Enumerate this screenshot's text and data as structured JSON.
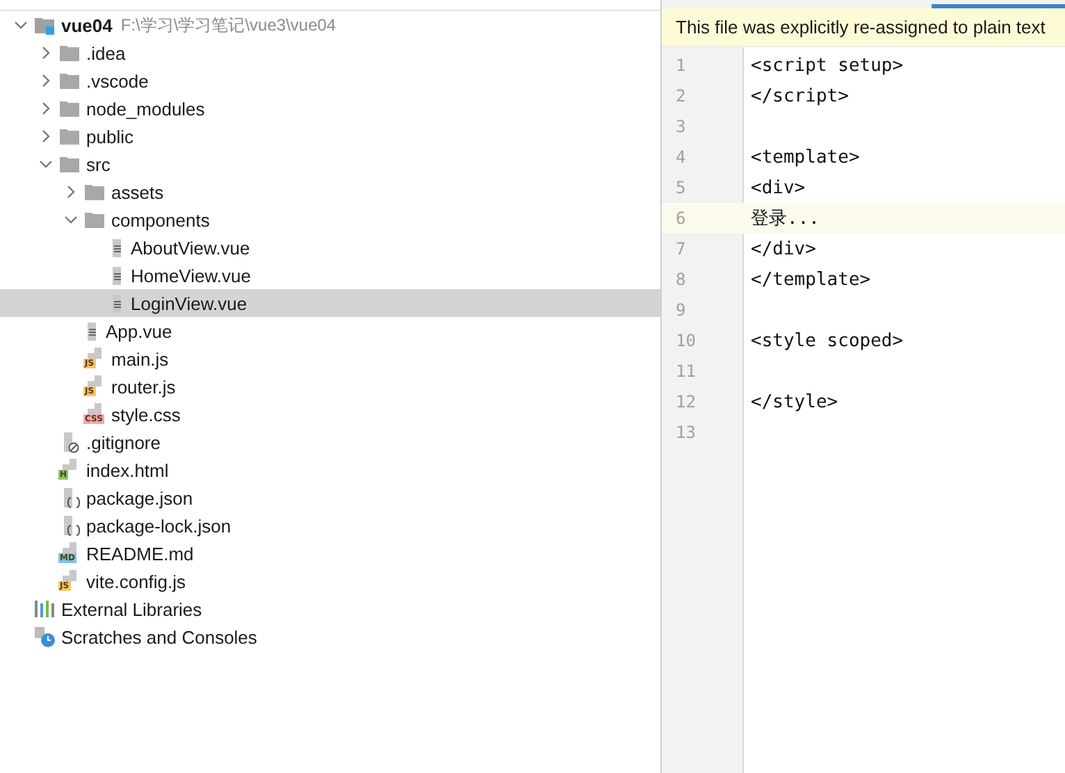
{
  "tree": [
    {
      "kind": "module",
      "label": "vue04",
      "path": "F:\\学习\\学习笔记\\vue3\\vue04",
      "expanded": true,
      "selected": false,
      "children": [
        {
          "kind": "folder",
          "label": ".idea",
          "expanded": false,
          "selected": false
        },
        {
          "kind": "folder",
          "label": ".vscode",
          "expanded": false,
          "selected": false
        },
        {
          "kind": "folder",
          "label": "node_modules",
          "expanded": false,
          "selected": false
        },
        {
          "kind": "folder",
          "label": "public",
          "expanded": false,
          "selected": false
        },
        {
          "kind": "folder",
          "label": "src",
          "expanded": true,
          "selected": false,
          "children": [
            {
              "kind": "folder",
              "label": "assets",
              "expanded": false,
              "selected": false
            },
            {
              "kind": "folder",
              "label": "components",
              "expanded": true,
              "selected": false,
              "children": [
                {
                  "kind": "text",
                  "label": "AboutView.vue",
                  "selected": false
                },
                {
                  "kind": "text",
                  "label": "HomeView.vue",
                  "selected": false
                },
                {
                  "kind": "text",
                  "label": "LoginView.vue",
                  "selected": true
                }
              ]
            },
            {
              "kind": "text",
              "label": "App.vue",
              "selected": false
            },
            {
              "kind": "badge",
              "label": "main.js",
              "badge": "JS",
              "color": "#f4c56c",
              "selected": false
            },
            {
              "kind": "badge",
              "label": "router.js",
              "badge": "JS",
              "color": "#f4c56c",
              "selected": false
            },
            {
              "kind": "badge",
              "label": "style.css",
              "badge": "CSS",
              "color": "#f2a7b9",
              "selected": false
            }
          ]
        },
        {
          "kind": "ignore",
          "label": ".gitignore",
          "selected": false
        },
        {
          "kind": "badge",
          "label": "index.html",
          "badge": "H",
          "color": "#86c56a",
          "selected": false
        },
        {
          "kind": "json",
          "label": "package.json",
          "selected": false
        },
        {
          "kind": "json",
          "label": "package-lock.json",
          "selected": false
        },
        {
          "kind": "badge",
          "label": "README.md",
          "badge": "MD",
          "color": "#7cc3e6",
          "selected": false
        },
        {
          "kind": "badge",
          "label": "vite.config.js",
          "badge": "JS",
          "color": "#f4c56c",
          "selected": false
        }
      ]
    },
    {
      "kind": "libraries",
      "label": "External Libraries",
      "selected": false
    },
    {
      "kind": "scratches",
      "label": "Scratches and Consoles",
      "selected": false
    }
  ],
  "editor": {
    "notice": "This file was explicitly re-assigned to plain text",
    "lines": [
      {
        "number": "1",
        "text": "<script setup>",
        "current": false
      },
      {
        "number": "2",
        "text": "</script>",
        "current": false
      },
      {
        "number": "3",
        "current": false
      },
      {
        "number": "4",
        "text": "<template>",
        "current": false
      },
      {
        "number": "5",
        "text": "<div>",
        "current": false
      },
      {
        "number": "6",
        "text": "登录...",
        "current": true
      },
      {
        "number": "7",
        "text": "</div>",
        "current": false
      },
      {
        "number": "8",
        "text": "</template>",
        "current": false
      },
      {
        "number": "9",
        "current": false
      },
      {
        "number": "10",
        "text": "<style scoped>",
        "current": false
      },
      {
        "number": "11",
        "current": false
      },
      {
        "number": "12",
        "text": "</style>",
        "current": false
      },
      {
        "number": "13",
        "current": false
      }
    ]
  }
}
